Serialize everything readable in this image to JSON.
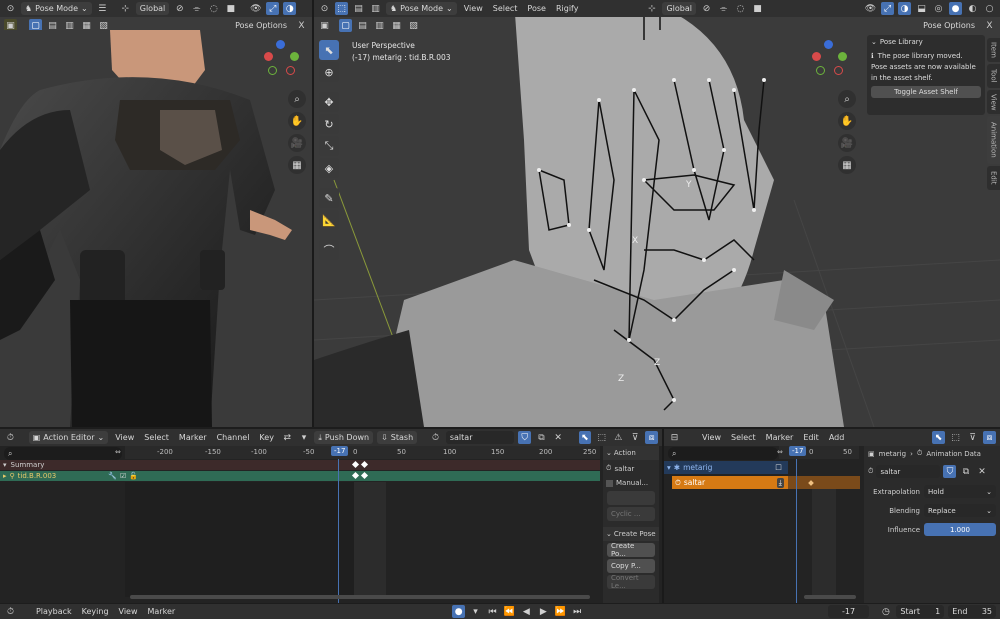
{
  "left_viewport": {
    "mode": "Pose Mode",
    "orientation": "Global",
    "pose_options": "Pose Options",
    "close_x": "X"
  },
  "main_viewport": {
    "mode": "Pose Mode",
    "menus": [
      "View",
      "Select",
      "Pose",
      "Rigify"
    ],
    "orientation": "Global",
    "pose_options": "Pose Options",
    "close_x": "X",
    "overlay_line1": "User Perspective",
    "overlay_line2": "(-17) metarig : tid.B.R.003",
    "axis_z": "Z",
    "axis_y": "Y",
    "axis_x": "X"
  },
  "pose_library": {
    "title": "Pose Library",
    "msg1": "The pose library moved.",
    "msg2": "Pose assets are now available",
    "msg3": "in the asset shelf.",
    "button": "Toggle Asset Shelf"
  },
  "right_tabs": [
    "Item",
    "Tool",
    "View",
    "Animation",
    "Edit"
  ],
  "action_editor": {
    "editor_label": "Action Editor",
    "menus": [
      "View",
      "Select",
      "Marker",
      "Channel",
      "Key"
    ],
    "push_down": "Push Down",
    "stash": "Stash",
    "action_name": "saltar",
    "ruler": [
      "-200",
      "-150",
      "-100",
      "-50",
      "-17",
      "0",
      "50",
      "100",
      "150",
      "200",
      "250"
    ],
    "channels": [
      "Summary",
      "tid.B.R.003"
    ]
  },
  "action_side": {
    "action_header": "Action",
    "action_value": "saltar",
    "manual": "Manual...",
    "cyclic": "Cyclic ...",
    "create_pose_header": "Create Pose",
    "create_pose_btn": "Create Po...",
    "copy_pose_btn": "Copy P...",
    "convert_btn": "Convert Le..."
  },
  "nla": {
    "menus": [
      "View",
      "Select",
      "Marker",
      "Edit",
      "Add"
    ],
    "ruler": [
      "-17",
      "0",
      "50"
    ],
    "track_object": "metarig",
    "track_action": "saltar"
  },
  "nla_side": {
    "object": "metarig",
    "animation_data": "Animation Data",
    "action": "saltar",
    "extrapolation_label": "Extrapolation",
    "extrapolation_value": "Hold",
    "blending_label": "Blending",
    "blending_value": "Replace",
    "influence_label": "Influence",
    "influence_value": "1.000"
  },
  "bottom_bar": {
    "menus": [
      "Playback",
      "Keying",
      "View",
      "Marker"
    ],
    "current_frame": "-17",
    "start_label": "Start",
    "start_value": "1",
    "end_label": "End",
    "end_value": "35"
  },
  "colors": {
    "accent": "#4772b3",
    "header": "#303030",
    "nla_orange": "#d67a14",
    "channel_green": "#2f6b55",
    "summary_red": "#4a2a2a"
  }
}
